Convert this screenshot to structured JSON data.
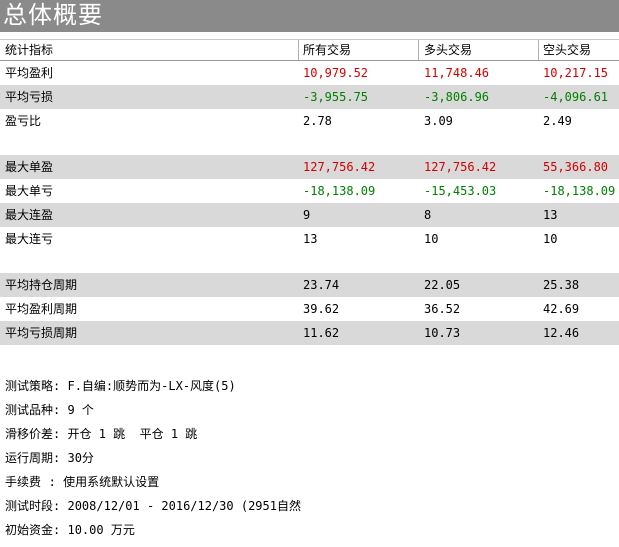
{
  "page_title": "总体概要",
  "header": {
    "metric": "统计指标",
    "all": "所有交易",
    "long": "多头交易",
    "short": "空头交易"
  },
  "rows": [
    {
      "label": "平均盈利",
      "all": "10,979.52",
      "long": "11,748.46",
      "short": "10,217.15"
    },
    {
      "label": "平均亏损",
      "all": "-3,955.75",
      "long": "-3,806.96",
      "short": "-4,096.61"
    },
    {
      "label": "盈亏比",
      "all": "2.78",
      "long": "3.09",
      "short": "2.49"
    },
    {
      "label": "最大单盈",
      "all": "127,756.42",
      "long": "127,756.42",
      "short": "55,366.80"
    },
    {
      "label": "最大单亏",
      "all": "-18,138.09",
      "long": "-15,453.03",
      "short": "-18,138.09"
    },
    {
      "label": "最大连盈",
      "all": "9",
      "long": "8",
      "short": "13"
    },
    {
      "label": "最大连亏",
      "all": "13",
      "long": "10",
      "short": "10"
    },
    {
      "label": "平均持仓周期",
      "all": "23.74",
      "long": "22.05",
      "short": "25.38"
    },
    {
      "label": "平均盈利周期",
      "all": "39.62",
      "long": "36.52",
      "short": "42.69"
    },
    {
      "label": "平均亏损周期",
      "all": "11.62",
      "long": "10.73",
      "short": "12.46"
    }
  ],
  "info": [
    {
      "label": "测试策略",
      "value": "F.自编:顺势而为-LX-风度(5)"
    },
    {
      "label": "测试品种",
      "value": "9 个"
    },
    {
      "label": "滑移价差",
      "value": "开仓 1 跳  平仓 1 跳"
    },
    {
      "label": "运行周期",
      "value": "30分"
    },
    {
      "label": "手续费  ",
      "value": "使用系统默认设置"
    },
    {
      "label": "测试时段",
      "value": "2008/12/01 - 2016/12/30 (2951自然"
    },
    {
      "label": "初始资金",
      "value": "10.00 万元"
    }
  ],
  "info_separator": ": ",
  "colors": {
    "title_bar": "#8a8a8a",
    "shaded_row": "#d9d9d9",
    "profit": "#d40000",
    "loss": "#008000"
  }
}
